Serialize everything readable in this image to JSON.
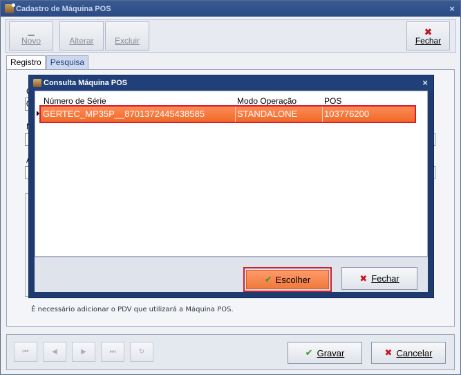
{
  "window": {
    "title": "Cadastro de Máquina POS",
    "close_glyph": "×"
  },
  "toolbar": {
    "novo_label": "Novo",
    "alterar_label": "Alterar",
    "excluir_label": "Excluir",
    "fechar_label": "Fechar"
  },
  "tabs": [
    "Registro",
    "Pesquisa"
  ],
  "form": {
    "partial_labels": [
      "C",
      "0",
      "N",
      "A"
    ],
    "hint": "É necessário adicionar o PDV que utilizará a Máquina POS."
  },
  "nav": {
    "buttons": [
      "first",
      "prev",
      "next",
      "last",
      "refresh"
    ]
  },
  "footer": {
    "gravar_label": "Gravar",
    "cancelar_label": "Cancelar"
  },
  "dialog": {
    "title": "Consulta Máquina POS",
    "columns": [
      "Número de Série",
      "Modo Operação",
      "POS"
    ],
    "rows": [
      {
        "serie": "GERTEC_MP35P__8701372445438585",
        "modo": "STANDALONE",
        "pos": "103776200"
      }
    ],
    "escolher_label": "Escolher",
    "fechar_label": "Fechar"
  },
  "colors": {
    "selection": "#f06a2a",
    "highlight_border": "#d81c2c",
    "titlebar": "#2a4a85"
  }
}
